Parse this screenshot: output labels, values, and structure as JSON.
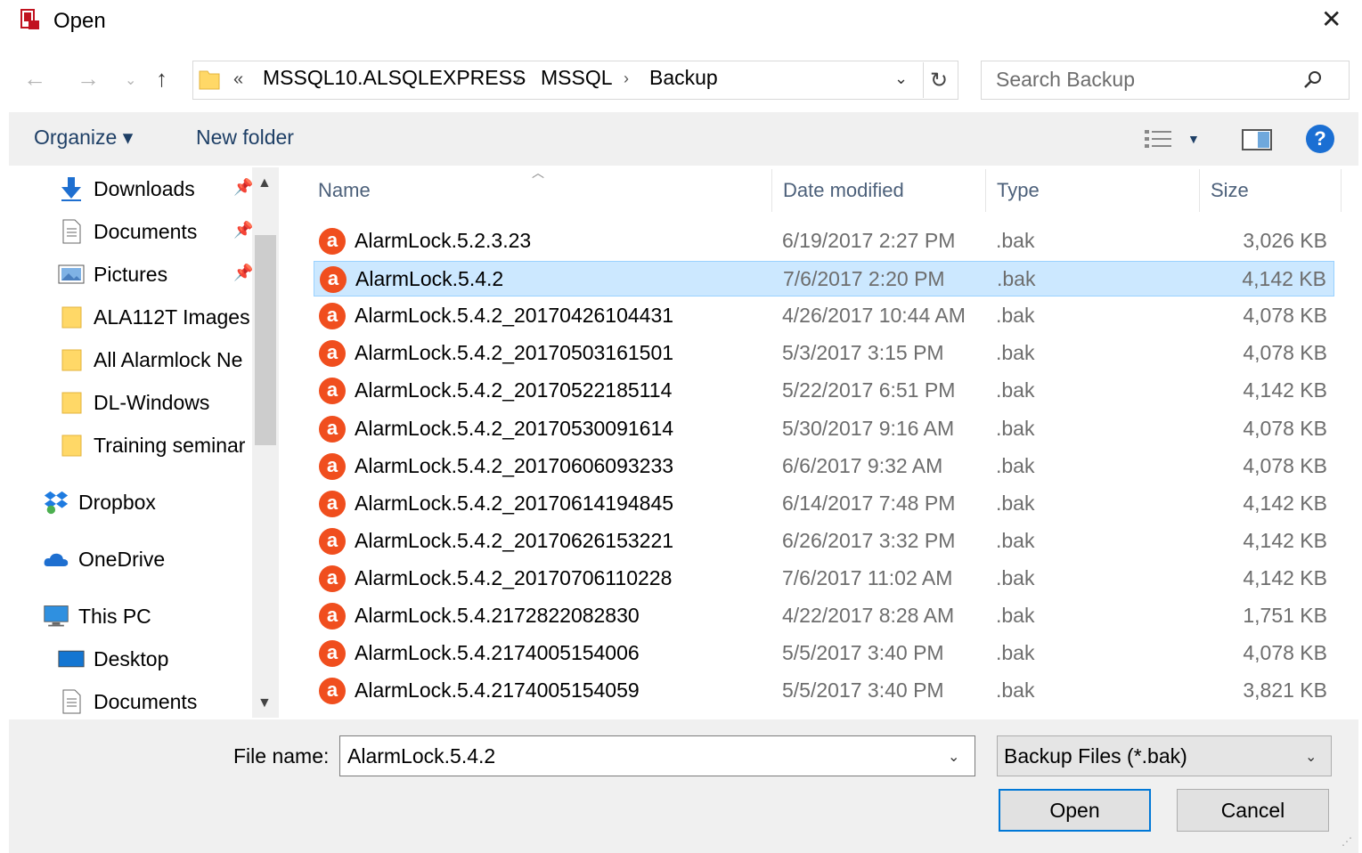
{
  "window": {
    "title": "Open",
    "close_label": "✕"
  },
  "address": {
    "overflow": "«",
    "crumbs": [
      "MSSQL10.ALSQLEXPRESS",
      "MSSQL",
      "Backup"
    ],
    "separator": "›"
  },
  "search": {
    "placeholder": "Search Backup"
  },
  "toolbar": {
    "organize": "Organize ▾",
    "new_folder": "New folder",
    "help": "?"
  },
  "nav": {
    "items": [
      {
        "label": "Downloads",
        "icon": "download-arrow-icon",
        "pinned": true
      },
      {
        "label": "Documents",
        "icon": "document-icon",
        "pinned": true
      },
      {
        "label": "Pictures",
        "icon": "pictures-icon",
        "pinned": true
      },
      {
        "label": "ALA112T Images",
        "icon": "folder-icon"
      },
      {
        "label": "All Alarmlock Ne",
        "icon": "folder-icon"
      },
      {
        "label": "DL-Windows",
        "icon": "folder-icon"
      },
      {
        "label": "Training seminar",
        "icon": "folder-icon"
      },
      {
        "label": "Dropbox",
        "icon": "dropbox-icon"
      },
      {
        "label": "OneDrive",
        "icon": "cloud-icon"
      },
      {
        "label": "This PC",
        "icon": "computer-icon"
      },
      {
        "label": "Desktop",
        "icon": "desktop-icon"
      },
      {
        "label": "Documents",
        "icon": "document-icon"
      }
    ]
  },
  "columns": {
    "name": "Name",
    "date": "Date modified",
    "type": "Type",
    "size": "Size"
  },
  "files": [
    {
      "name": "AlarmLock.5.2.3.23",
      "date": "6/19/2017 2:27 PM",
      "type": ".bak",
      "size": "3,026 KB",
      "selected": false
    },
    {
      "name": "AlarmLock.5.4.2",
      "date": "7/6/2017 2:20 PM",
      "type": ".bak",
      "size": "4,142 KB",
      "selected": true
    },
    {
      "name": "AlarmLock.5.4.2_20170426104431",
      "date": "4/26/2017 10:44 AM",
      "type": ".bak",
      "size": "4,078 KB",
      "selected": false
    },
    {
      "name": "AlarmLock.5.4.2_20170503161501",
      "date": "5/3/2017 3:15 PM",
      "type": ".bak",
      "size": "4,078 KB",
      "selected": false
    },
    {
      "name": "AlarmLock.5.4.2_20170522185114",
      "date": "5/22/2017 6:51 PM",
      "type": ".bak",
      "size": "4,142 KB",
      "selected": false
    },
    {
      "name": "AlarmLock.5.4.2_20170530091614",
      "date": "5/30/2017 9:16 AM",
      "type": ".bak",
      "size": "4,078 KB",
      "selected": false
    },
    {
      "name": "AlarmLock.5.4.2_20170606093233",
      "date": "6/6/2017 9:32 AM",
      "type": ".bak",
      "size": "4,078 KB",
      "selected": false
    },
    {
      "name": "AlarmLock.5.4.2_20170614194845",
      "date": "6/14/2017 7:48 PM",
      "type": ".bak",
      "size": "4,142 KB",
      "selected": false
    },
    {
      "name": "AlarmLock.5.4.2_20170626153221",
      "date": "6/26/2017 3:32 PM",
      "type": ".bak",
      "size": "4,142 KB",
      "selected": false
    },
    {
      "name": "AlarmLock.5.4.2_20170706110228",
      "date": "7/6/2017 11:02 AM",
      "type": ".bak",
      "size": "4,142 KB",
      "selected": false
    },
    {
      "name": "AlarmLock.5.4.2172822082830",
      "date": "4/22/2017 8:28 AM",
      "type": ".bak",
      "size": "1,751 KB",
      "selected": false
    },
    {
      "name": "AlarmLock.5.4.2174005154006",
      "date": "5/5/2017 3:40 PM",
      "type": ".bak",
      "size": "4,078 KB",
      "selected": false
    },
    {
      "name": "AlarmLock.5.4.2174005154059",
      "date": "5/5/2017 3:40 PM",
      "type": ".bak",
      "size": "3,821 KB",
      "selected": false
    }
  ],
  "file_icon_letter": "a",
  "bottom": {
    "file_name_label": "File name:",
    "file_name_value": "AlarmLock.5.4.2",
    "file_type": "Backup Files (*.bak)",
    "open": "Open",
    "cancel": "Cancel"
  },
  "colors": {
    "accent": "#0078d7",
    "selection": "#cce8ff",
    "file_icon": "#f04e1e",
    "link": "#1e3f66"
  }
}
